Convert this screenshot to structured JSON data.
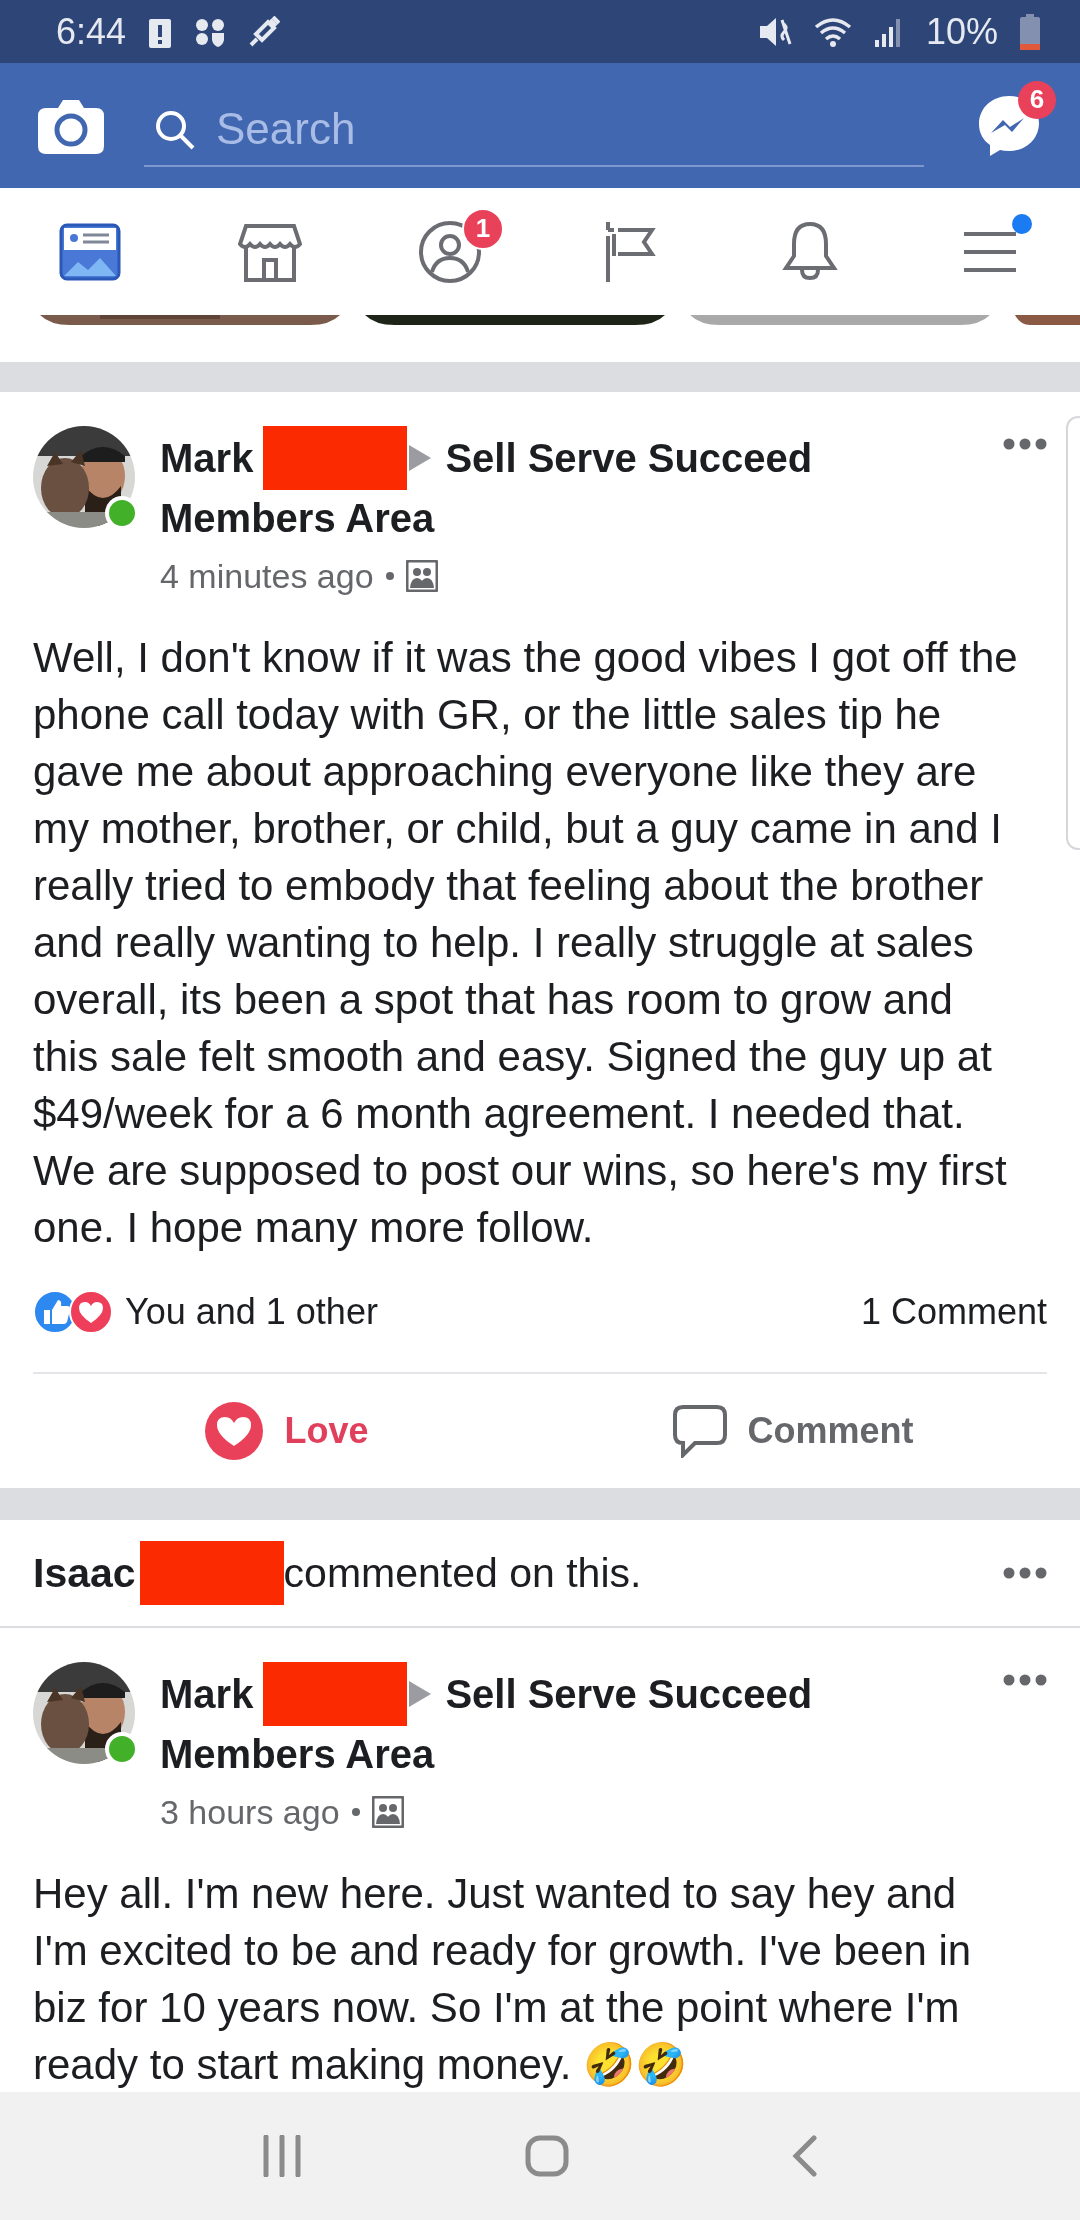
{
  "status_bar": {
    "time": "6:44",
    "battery": "10%"
  },
  "header": {
    "search": {
      "placeholder": "Search"
    },
    "messenger_badge": "6"
  },
  "tabs": [
    {
      "kind": "feed",
      "selected": true
    },
    {
      "kind": "marketplace",
      "selected": false
    },
    {
      "kind": "profile",
      "selected": false,
      "badge": "1"
    },
    {
      "kind": "pages",
      "selected": false
    },
    {
      "kind": "notifications",
      "selected": false
    },
    {
      "kind": "menu",
      "selected": false,
      "dot": true
    }
  ],
  "posts": [
    {
      "author": "Mark",
      "redacted": true,
      "group_lines": [
        "Sell Serve Succeed",
        "Members Area"
      ],
      "online": true,
      "time": "4 minutes ago",
      "text": "Well, I don't know if it was the good vibes I got off the phone call today with GR, or the little sales tip he gave me about approaching everyone like they are my mother, brother, or child, but a guy came in and I really tried to embody that feeling about the brother and really wanting to help. I really struggle at sales overall, its been a spot that has room to grow and this sale felt smooth and easy. Signed the guy up at $49/week for a 6 month agreement. I needed that. We are supposed to post our wins, so here's my first one. I hope many more follow.",
      "reaction_icons": [
        {
          "kind": "like"
        },
        {
          "kind": "love"
        }
      ],
      "reactions": "You and 1 other",
      "comments": "1 Comment",
      "actions": [
        {
          "kind": "love",
          "label": "Love",
          "selected": true
        },
        {
          "kind": "comment",
          "label": "Comment",
          "selected": false
        }
      ]
    },
    {
      "context": {
        "name": "Isaac",
        "redacted": true,
        "text": "commented on this."
      },
      "author": "Mark",
      "redacted": true,
      "group_lines": [
        "Sell Serve Succeed",
        "Members Area"
      ],
      "online": true,
      "time": "3 hours ago",
      "text": "Hey all. I'm new here. Just wanted to say hey and I'm excited to be and ready for growth. I've been in biz for 10 years now. So I'm at the point where I'm ready to start making money. 🤣🤣"
    }
  ]
}
